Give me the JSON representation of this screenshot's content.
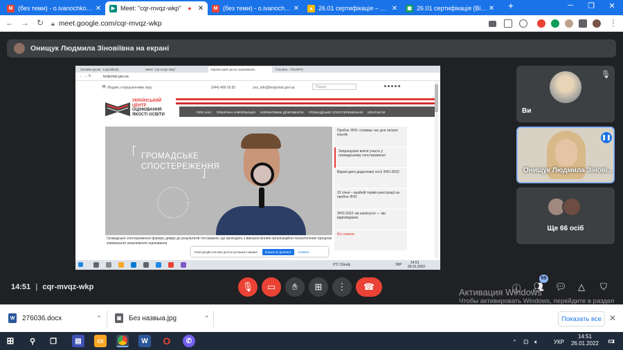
{
  "browser": {
    "tabs": [
      {
        "title": "(без теми) - o.ivanochko@ip...",
        "icon": "gmail-icon",
        "color": "#ea4335",
        "active": false
      },
      {
        "title": "Meet: \"cqr-mvqz-wkp\"",
        "icon": "meet-icon",
        "color": "#00897b",
        "active": true
      },
      {
        "title": "(без теми) - o.ivanochko@ip...",
        "icon": "gmail-icon",
        "color": "#ea4335",
        "active": false
      },
      {
        "title": "26.01 сертифікація – Google...",
        "icon": "drive-icon",
        "color": "#fbbc04",
        "active": false
      },
      {
        "title": "26.01 сертифікація (Відпов...",
        "icon": "sheets-icon",
        "color": "#0f9d58",
        "active": false
      }
    ],
    "new_tab": "+",
    "url": "meet.google.com/cqr-mvqz-wkp"
  },
  "meet": {
    "presenter_banner": "Онищук Людмила Зіновіївна на екрані",
    "meeting_time": "14:51",
    "meeting_code": "cqr-mvqz-wkp",
    "participants": [
      {
        "name": "Ви"
      },
      {
        "name": "Онищук Людмила Зінові..."
      },
      {
        "name": "Ще 66 осіб"
      }
    ],
    "participant_count": "69",
    "colors": {
      "end_call": "#ea4335",
      "muted": "#ea4335",
      "active_speaker": "#8ab4f8"
    }
  },
  "shared_screen": {
    "inner_tabs": [
      "Онлайн-уроки - lurprofile@...",
      "Meet: \"cqr-mvqz-wkp\"",
      "Український центр оцінювання...",
      "Головна - TOURFG"
    ],
    "inner_url": "testportal.gov.ua",
    "top_left": "Людям з порушеннями зору",
    "phone": "(044) 486 09 82",
    "email": "zno_info@testportal.gov.ua",
    "search_placeholder": "Пошук",
    "logo": [
      "УКРАЇНСЬКИЙ",
      "ЦЕНТР",
      "ОЦІНЮВАННЯ",
      "ЯКОСТІ ОСВІТИ"
    ],
    "nav": [
      "ПРО НАС",
      "ПУБЛІЧНА ІНФОРМАЦІЯ",
      "НОРМАТИВНІ ДОКУМЕНТИ",
      "ГРОМАДСЬКЕ СПОСТЕРЕЖЕННЯ",
      "КОНТАКТИ"
    ],
    "hero_title_1": "ГРОМАДСЬКЕ",
    "hero_title_2": "СПОСТЕРЕЖЕННЯ",
    "news": [
      "Пробне ЗНО: спливає час для оплати коштів",
      "Запрошуємо взяти участь у громадському спостереженні",
      "Відомі дати додаткової сесії ЗНО-2022",
      "22 січня – крайній термін реєстрації на пробне ЗНО",
      "ЗНО-2022: ви запитуєте — ми відповідаємо",
      "Всі новини"
    ],
    "caption": "Громадське спостереження формує довіру до результатів тестування, що проходить з використанням організаційно-технологічних процесів зовнішнього незалежного оцінювання",
    "share_banner_text": "meet.google.com має доступ до вашого екрана.",
    "share_stop": "Більше не ділитися",
    "share_hide": "Сховати",
    "weather": "0°C Cloudy",
    "lang": "УКР",
    "inner_time": "14:51",
    "inner_date": "26.01.2022"
  },
  "activation": {
    "title": "Активация Windows",
    "text": "Чтобы активировать Windows, перейдите в раздел \"Параметры\"."
  },
  "downloads": {
    "items": [
      {
        "name": "276036.docx",
        "icon": "word-doc-icon"
      },
      {
        "name": "Без назвыа.jpg",
        "icon": "image-file-icon"
      }
    ],
    "show_all": "Показать все",
    "close": "✕"
  },
  "taskbar": {
    "lang": "УКР",
    "time": "14:51",
    "date": "26.01.2022",
    "notifications": "2"
  }
}
